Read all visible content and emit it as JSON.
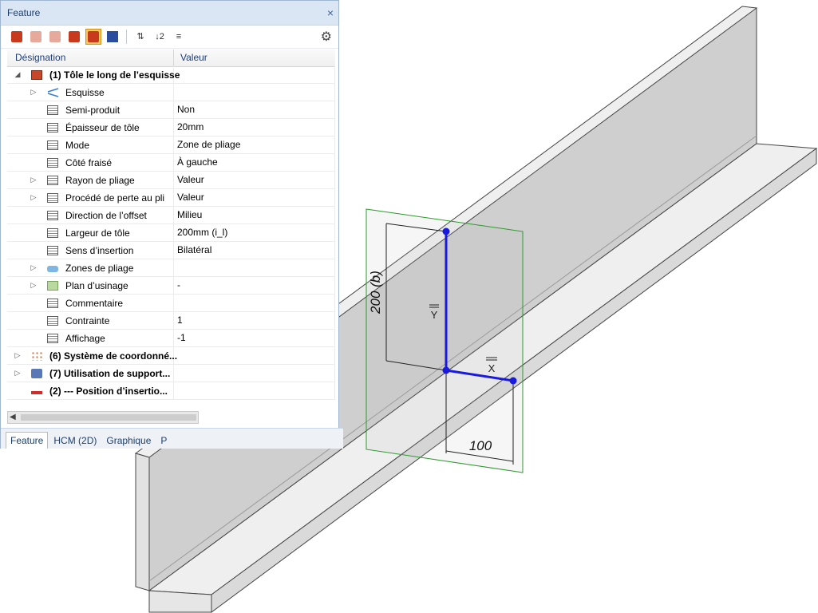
{
  "panel": {
    "title": "Feature",
    "close_glyph": "×",
    "toolbar": [
      {
        "icon": "pdf-icon",
        "kind": "pdf",
        "active": false,
        "dim": false
      },
      {
        "icon": "pdf-icon",
        "kind": "pdf",
        "active": false,
        "dim": true
      },
      {
        "icon": "pdf-icon",
        "kind": "pdf",
        "active": false,
        "dim": true
      },
      {
        "icon": "pdf-icon",
        "kind": "pdf",
        "active": false,
        "dim": false
      },
      {
        "icon": "pdf-icon",
        "kind": "pdf",
        "active": true,
        "dim": false
      },
      {
        "icon": "arrow-icon",
        "kind": "arrow",
        "active": false,
        "dim": false
      },
      {
        "icon": "sort-icon",
        "kind": "sort",
        "glyph": "⇅",
        "active": false,
        "dim": false
      },
      {
        "icon": "sort-icon",
        "kind": "sort",
        "glyph": "↓2",
        "active": false,
        "dim": false
      },
      {
        "icon": "sort-icon",
        "kind": "sort",
        "glyph": "≡",
        "active": false,
        "dim": false
      }
    ],
    "settings_icon": "gear-icon",
    "columns": {
      "designation": "Désignation",
      "valeur": "Valeur"
    },
    "rows": [
      {
        "level": 0,
        "expand": "◢",
        "icon": "part",
        "label": "(1) Tôle le long de l’esquisse",
        "value": "",
        "bold": true
      },
      {
        "level": 1,
        "expand": "▷",
        "icon": "sketch",
        "label": "Esquisse",
        "value": "",
        "bold": false
      },
      {
        "level": 1,
        "expand": "",
        "icon": "prop",
        "label": "Semi-produit",
        "value": "Non",
        "bold": false
      },
      {
        "level": 1,
        "expand": "",
        "icon": "prop",
        "label": "Épaisseur de tôle",
        "value": "20mm",
        "bold": false
      },
      {
        "level": 1,
        "expand": "",
        "icon": "prop",
        "label": "Mode",
        "value": "Zone de pliage",
        "bold": false
      },
      {
        "level": 1,
        "expand": "",
        "icon": "prop",
        "label": "Côté fraisé",
        "value": "À gauche",
        "bold": false
      },
      {
        "level": 1,
        "expand": "▷",
        "icon": "prop",
        "label": "Rayon de pliage",
        "value": "Valeur",
        "bold": false
      },
      {
        "level": 1,
        "expand": "▷",
        "icon": "prop",
        "label": "Procédé de perte au pli",
        "value": "Valeur",
        "bold": false
      },
      {
        "level": 1,
        "expand": "",
        "icon": "prop",
        "label": "Direction de l’offset",
        "value": "Milieu",
        "bold": false
      },
      {
        "level": 1,
        "expand": "",
        "icon": "prop",
        "label": "Largeur de tôle",
        "value": "200mm (i_l)",
        "bold": false
      },
      {
        "level": 1,
        "expand": "",
        "icon": "prop",
        "label": "Sens d’insertion",
        "value": "Bilatéral",
        "bold": false
      },
      {
        "level": 1,
        "expand": "▷",
        "icon": "zones",
        "label": "Zones de pliage",
        "value": "",
        "bold": false
      },
      {
        "level": 1,
        "expand": "▷",
        "icon": "plane",
        "label": "Plan d’usinage",
        "value": "-",
        "bold": false
      },
      {
        "level": 1,
        "expand": "",
        "icon": "prop",
        "label": "Commentaire",
        "value": "",
        "bold": false
      },
      {
        "level": 1,
        "expand": "",
        "icon": "prop",
        "label": "Contrainte",
        "value": "1",
        "bold": false
      },
      {
        "level": 1,
        "expand": "",
        "icon": "prop",
        "label": "Affichage",
        "value": "-1",
        "bold": false
      },
      {
        "level": 0,
        "expand": "▷",
        "icon": "coord",
        "label": "(6) Système de coordonné...",
        "value": "",
        "bold": true
      },
      {
        "level": 0,
        "expand": "▷",
        "icon": "support",
        "label": "(7) Utilisation de support...",
        "value": "",
        "bold": true
      },
      {
        "level": 0,
        "expand": "",
        "icon": "arrowr",
        "label": "(2) --- Position  d’insertio...",
        "value": "",
        "bold": true
      }
    ],
    "tabs": [
      "Feature",
      "HCM (2D)",
      "Graphique",
      "P"
    ],
    "active_tab": 0
  },
  "viewport": {
    "dim_vertical": "200 (b)",
    "dim_horizontal": "100",
    "axis_y": "Y",
    "axis_x": "X",
    "colors": {
      "sheet_face": "#d0d0d0",
      "sheet_top": "#efefef",
      "axis": "#1a1adf",
      "plane": "#2d9a2d"
    }
  }
}
